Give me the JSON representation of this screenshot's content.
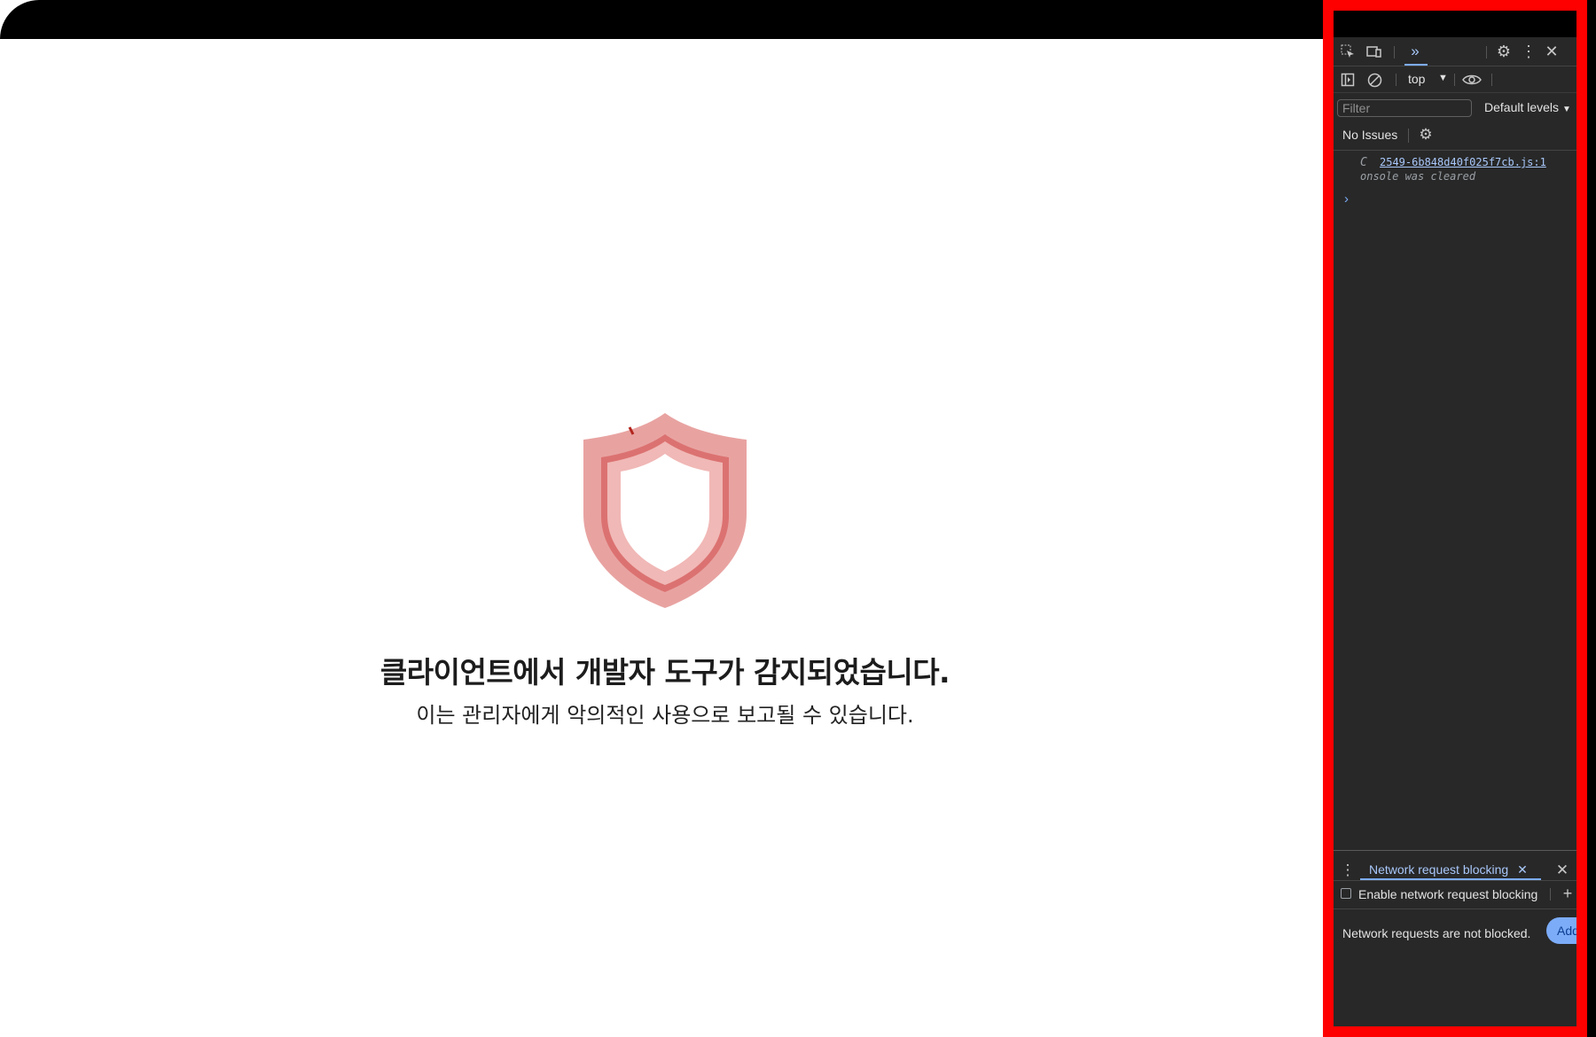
{
  "page": {
    "headline": "클라이언트에서 개발자 도구가 감지되었습니다.",
    "subline": "이는 관리자에게 악의적인 사용으로 보고될 수 있습니다.",
    "shield_icon": "shield-icon",
    "accent_color": "#e07373"
  },
  "devtools": {
    "toolbar": {
      "inspect_icon": "inspect-element-icon",
      "device_icon": "device-toggle-icon",
      "more_tabs_icon": "chevron-double-right-icon",
      "settings_icon": "gear-icon",
      "menu_icon": "kebab-menu-icon",
      "close_icon": "close-icon"
    },
    "console": {
      "context": "top",
      "filter_placeholder": "Filter",
      "levels": "Default levels",
      "issues": "No Issues",
      "log_prefix": "C",
      "log_source": "2549-6b848d40f025f7cb.js:1",
      "log_message": "onsole was cleared"
    },
    "drawer": {
      "tab_label": "Network request blocking",
      "enable_label": "Enable network request blocking",
      "status_text": "Network requests are not blocked.",
      "add_button": "Add"
    },
    "border_color": "#ff0000"
  }
}
